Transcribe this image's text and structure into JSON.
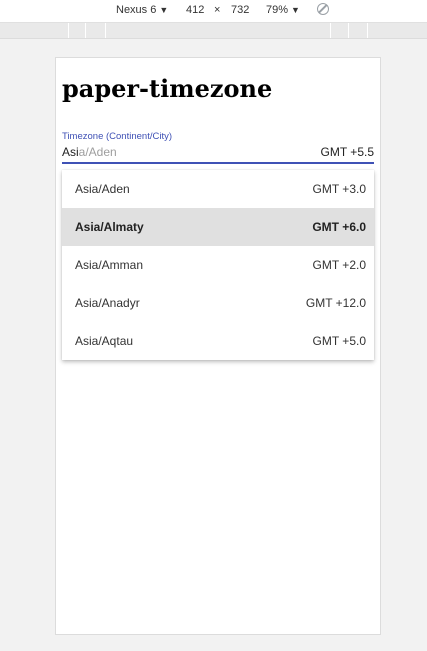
{
  "devtools": {
    "device": "Nexus 6",
    "width": "412",
    "times": "×",
    "height": "732",
    "zoom": "79%"
  },
  "page": {
    "title": "paper-timezone"
  },
  "timezone_field": {
    "label": "Timezone (Continent/City)",
    "typed": "Asi",
    "completion": "a/Aden",
    "offset": "GMT +5.5"
  },
  "options": [
    {
      "name": "Asia/Aden",
      "offset": "GMT +3.0",
      "selected": false
    },
    {
      "name": "Asia/Almaty",
      "offset": "GMT +6.0",
      "selected": true
    },
    {
      "name": "Asia/Amman",
      "offset": "GMT +2.0",
      "selected": false
    },
    {
      "name": "Asia/Anadyr",
      "offset": "GMT +12.0",
      "selected": false
    },
    {
      "name": "Asia/Aqtau",
      "offset": "GMT +5.0",
      "selected": false
    }
  ]
}
